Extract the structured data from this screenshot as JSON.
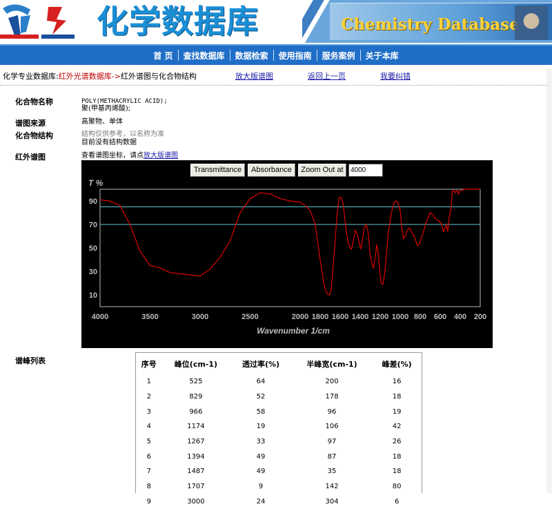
{
  "banner": {
    "title_cn": "化学数据库",
    "title_en": "Chemistry Database"
  },
  "nav": [
    "首 页",
    "查找数据库",
    "数据检索",
    "使用指南",
    "服务案例",
    "关于本库"
  ],
  "breadcrumb": {
    "prefix": "化学专业数据库:",
    "db": "红外光谱数据库",
    "arrow": "->",
    "page": "红外谱图与化合物结构",
    "links": [
      "放大版谱图",
      "返回上一页",
      "我要纠错"
    ]
  },
  "compound": {
    "name_label": "化合物名称",
    "name_en": "POLY(METHACRYLIC ACID);",
    "name_cn": "聚(甲基丙烯酸);",
    "source_label": "谱图来源",
    "source": "高聚物、单体",
    "structure_label": "化合物结构",
    "structure_note": "结构仅供参考，以名称为准",
    "structure_missing": "目前没有结构数据",
    "ir_label": "红外谱图",
    "ir_hint": "查看谱图坐标，请点",
    "ir_link": "放大版谱图"
  },
  "chart_controls": {
    "transmittance": "Transmittance",
    "absorbance": "Absorbance",
    "zoom_out": "Zoom Out at",
    "zoom_value": "4000"
  },
  "chart_data": {
    "type": "line",
    "ylabel": "T %",
    "xlabel": "Wavenumber 1/cm",
    "xlim": [
      4000,
      200
    ],
    "ylim": [
      0,
      100
    ],
    "x_ticks": [
      4000,
      3500,
      3000,
      2500,
      2000,
      1800,
      1600,
      1400,
      1200,
      1000,
      800,
      600,
      400,
      200
    ],
    "y_ticks": [
      10,
      30,
      50,
      70,
      90
    ],
    "reference_lines": [
      85,
      70
    ],
    "series": [
      {
        "color": "#e00000",
        "points": [
          [
            4000,
            91
          ],
          [
            3900,
            90
          ],
          [
            3800,
            86
          ],
          [
            3700,
            70
          ],
          [
            3600,
            47
          ],
          [
            3500,
            35
          ],
          [
            3400,
            33
          ],
          [
            3300,
            29
          ],
          [
            3200,
            28
          ],
          [
            3100,
            27
          ],
          [
            3000,
            26
          ],
          [
            2900,
            32
          ],
          [
            2800,
            42
          ],
          [
            2700,
            56
          ],
          [
            2600,
            80
          ],
          [
            2500,
            92
          ],
          [
            2400,
            97
          ],
          [
            2300,
            96
          ],
          [
            2200,
            92
          ],
          [
            2100,
            90
          ],
          [
            2000,
            89
          ],
          [
            1950,
            86
          ],
          [
            1900,
            82
          ],
          [
            1850,
            70
          ],
          [
            1800,
            40
          ],
          [
            1760,
            18
          ],
          [
            1730,
            11
          ],
          [
            1707,
            10
          ],
          [
            1690,
            14
          ],
          [
            1660,
            45
          ],
          [
            1630,
            80
          ],
          [
            1610,
            93
          ],
          [
            1590,
            93
          ],
          [
            1570,
            88
          ],
          [
            1540,
            65
          ],
          [
            1520,
            55
          ],
          [
            1500,
            50
          ],
          [
            1487,
            49
          ],
          [
            1470,
            55
          ],
          [
            1450,
            65
          ],
          [
            1430,
            62
          ],
          [
            1410,
            55
          ],
          [
            1394,
            49
          ],
          [
            1380,
            55
          ],
          [
            1360,
            67
          ],
          [
            1340,
            70
          ],
          [
            1320,
            63
          ],
          [
            1300,
            44
          ],
          [
            1280,
            36
          ],
          [
            1267,
            33
          ],
          [
            1250,
            42
          ],
          [
            1235,
            53
          ],
          [
            1220,
            45
          ],
          [
            1200,
            27
          ],
          [
            1190,
            20
          ],
          [
            1174,
            19
          ],
          [
            1160,
            25
          ],
          [
            1140,
            42
          ],
          [
            1120,
            62
          ],
          [
            1100,
            73
          ],
          [
            1080,
            83
          ],
          [
            1060,
            89
          ],
          [
            1040,
            90
          ],
          [
            1020,
            88
          ],
          [
            1000,
            82
          ],
          [
            985,
            68
          ],
          [
            966,
            58
          ],
          [
            950,
            60
          ],
          [
            930,
            65
          ],
          [
            910,
            67
          ],
          [
            890,
            64
          ],
          [
            860,
            60
          ],
          [
            840,
            55
          ],
          [
            829,
            52
          ],
          [
            810,
            53
          ],
          [
            790,
            58
          ],
          [
            760,
            66
          ],
          [
            730,
            74
          ],
          [
            700,
            80
          ],
          [
            670,
            78
          ],
          [
            640,
            74
          ],
          [
            610,
            73
          ],
          [
            590,
            71
          ],
          [
            570,
            64
          ],
          [
            555,
            66
          ],
          [
            540,
            70
          ],
          [
            525,
            64
          ],
          [
            510,
            76
          ],
          [
            500,
            80
          ],
          [
            490,
            87
          ],
          [
            480,
            98
          ],
          [
            470,
            99
          ],
          [
            450,
            97
          ],
          [
            440,
            99
          ],
          [
            430,
            99
          ],
          [
            420,
            96
          ],
          [
            400,
            99
          ],
          [
            380,
            99
          ],
          [
            360,
            100
          ],
          [
            200,
            100
          ]
        ]
      }
    ]
  },
  "peaks": {
    "label": "谱峰列表",
    "headers": [
      "序号",
      "峰位(cm-1)",
      "透过率(%)",
      "半峰宽(cm-1)",
      "峰差(%)"
    ],
    "rows": [
      [
        "1",
        "525",
        "64",
        "200",
        "16"
      ],
      [
        "2",
        "829",
        "52",
        "178",
        "18"
      ],
      [
        "3",
        "966",
        "58",
        "96",
        "19"
      ],
      [
        "4",
        "1174",
        "19",
        "106",
        "42"
      ],
      [
        "5",
        "1267",
        "33",
        "97",
        "26"
      ],
      [
        "6",
        "1394",
        "49",
        "87",
        "18"
      ],
      [
        "7",
        "1487",
        "49",
        "35",
        "18"
      ],
      [
        "8",
        "1707",
        "9",
        "142",
        "80"
      ],
      [
        "9",
        "3000",
        "24",
        "304",
        "6"
      ]
    ]
  }
}
